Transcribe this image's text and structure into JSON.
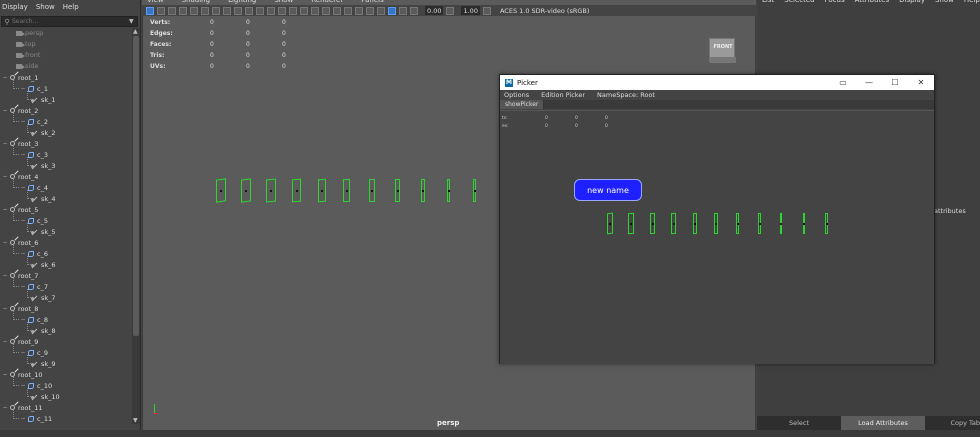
{
  "outliner": {
    "menu": [
      "Display",
      "Show",
      "Help"
    ],
    "search_placeholder": "Search...",
    "cameras": [
      "persp",
      "top",
      "front",
      "side"
    ],
    "groups": [
      {
        "root": "root_1",
        "curve": "c_1",
        "joint": "sk_1"
      },
      {
        "root": "root_2",
        "curve": "c_2",
        "joint": "sk_2"
      },
      {
        "root": "root_3",
        "curve": "c_3",
        "joint": "sk_3"
      },
      {
        "root": "root_4",
        "curve": "c_4",
        "joint": "sk_4"
      },
      {
        "root": "root_5",
        "curve": "c_5",
        "joint": "sk_5"
      },
      {
        "root": "root_6",
        "curve": "c_6",
        "joint": "sk_6"
      },
      {
        "root": "root_7",
        "curve": "c_7",
        "joint": "sk_7"
      },
      {
        "root": "root_8",
        "curve": "c_8",
        "joint": "sk_8"
      },
      {
        "root": "root_9",
        "curve": "c_9",
        "joint": "sk_9"
      },
      {
        "root": "root_10",
        "curve": "c_10",
        "joint": "sk_10"
      },
      {
        "root": "root_11",
        "curve": "c_11",
        "joint": ""
      }
    ]
  },
  "viewport": {
    "menu": [
      "View",
      "Shading",
      "Lighting",
      "Show",
      "Renderer",
      "Panels"
    ],
    "exposure": "0.00",
    "gamma": "1.00",
    "color_space": "ACES 1.0 SDR-video (sRGB)",
    "hud": [
      {
        "label": "Verts:",
        "values": [
          "0",
          "0",
          "0"
        ]
      },
      {
        "label": "Edges:",
        "values": [
          "0",
          "0",
          "0"
        ]
      },
      {
        "label": "Faces:",
        "values": [
          "0",
          "0",
          "0"
        ]
      },
      {
        "label": "Tris:",
        "values": [
          "0",
          "0",
          "0"
        ]
      },
      {
        "label": "UVs:",
        "values": [
          "0",
          "0",
          "0"
        ]
      }
    ],
    "viewcube_label": "FRONT",
    "camera_label": "persp",
    "accent_color": "#2ed52e"
  },
  "right_panel": {
    "menu": [
      "List",
      "Selected",
      "Focus",
      "Attributes",
      "Display",
      "Show",
      "Help"
    ],
    "attributes_text": "attributes",
    "buttons": [
      "Select",
      "Load Attributes",
      "Copy Tab"
    ]
  },
  "picker": {
    "title": "Picker",
    "menu": [
      "Options",
      "Edition Picker",
      "NameSpace: Root"
    ],
    "tab": "showPicker",
    "hud": [
      {
        "label": "ts:",
        "values": [
          "0",
          "0",
          "0"
        ]
      },
      {
        "label": "es:",
        "values": [
          "0",
          "0",
          "0"
        ]
      }
    ],
    "button_label": "new name",
    "button_color": "#1f20ff"
  }
}
